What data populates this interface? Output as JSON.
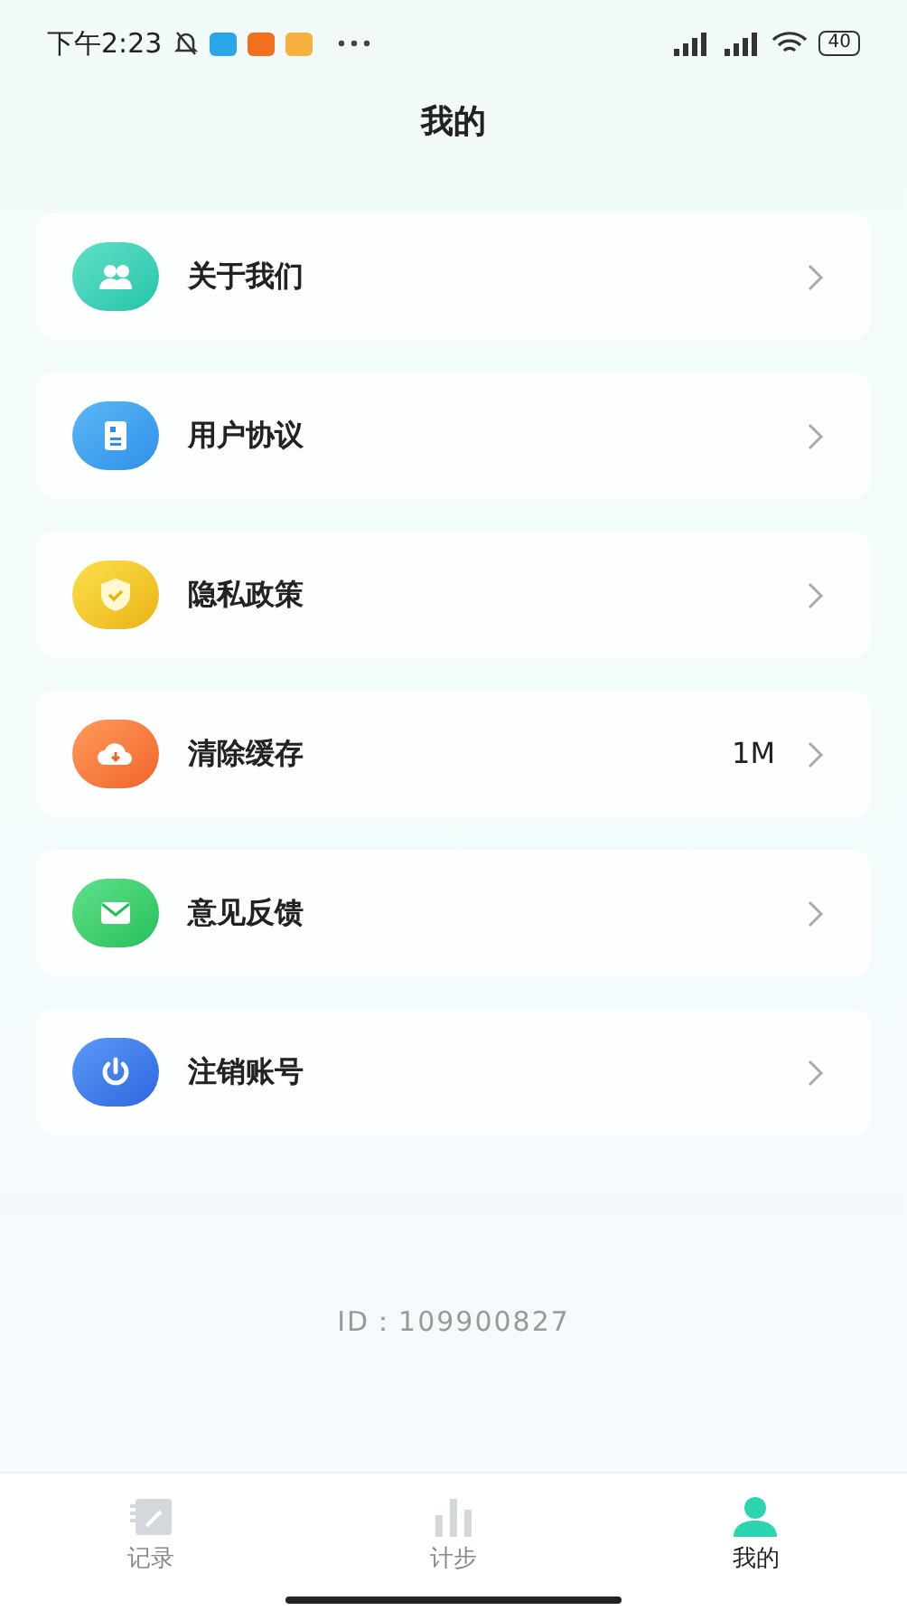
{
  "status_bar": {
    "time": "下午2:23",
    "battery": "40"
  },
  "header": {
    "title": "我的"
  },
  "menu": [
    {
      "kind": "about",
      "label": "关于我们"
    },
    {
      "kind": "agreement",
      "label": "用户协议"
    },
    {
      "kind": "privacy",
      "label": "隐私政策"
    },
    {
      "kind": "cache",
      "label": "清除缓存",
      "value": "1M"
    },
    {
      "kind": "feedback",
      "label": "意见反馈"
    },
    {
      "kind": "logout",
      "label": "注销账号"
    }
  ],
  "user_id": "ID：109900827",
  "tab_bar": [
    {
      "kind": "record",
      "label": "记录",
      "selected": false
    },
    {
      "kind": "steps",
      "label": "计步",
      "selected": false
    },
    {
      "kind": "me",
      "label": "我的",
      "selected": true
    }
  ]
}
